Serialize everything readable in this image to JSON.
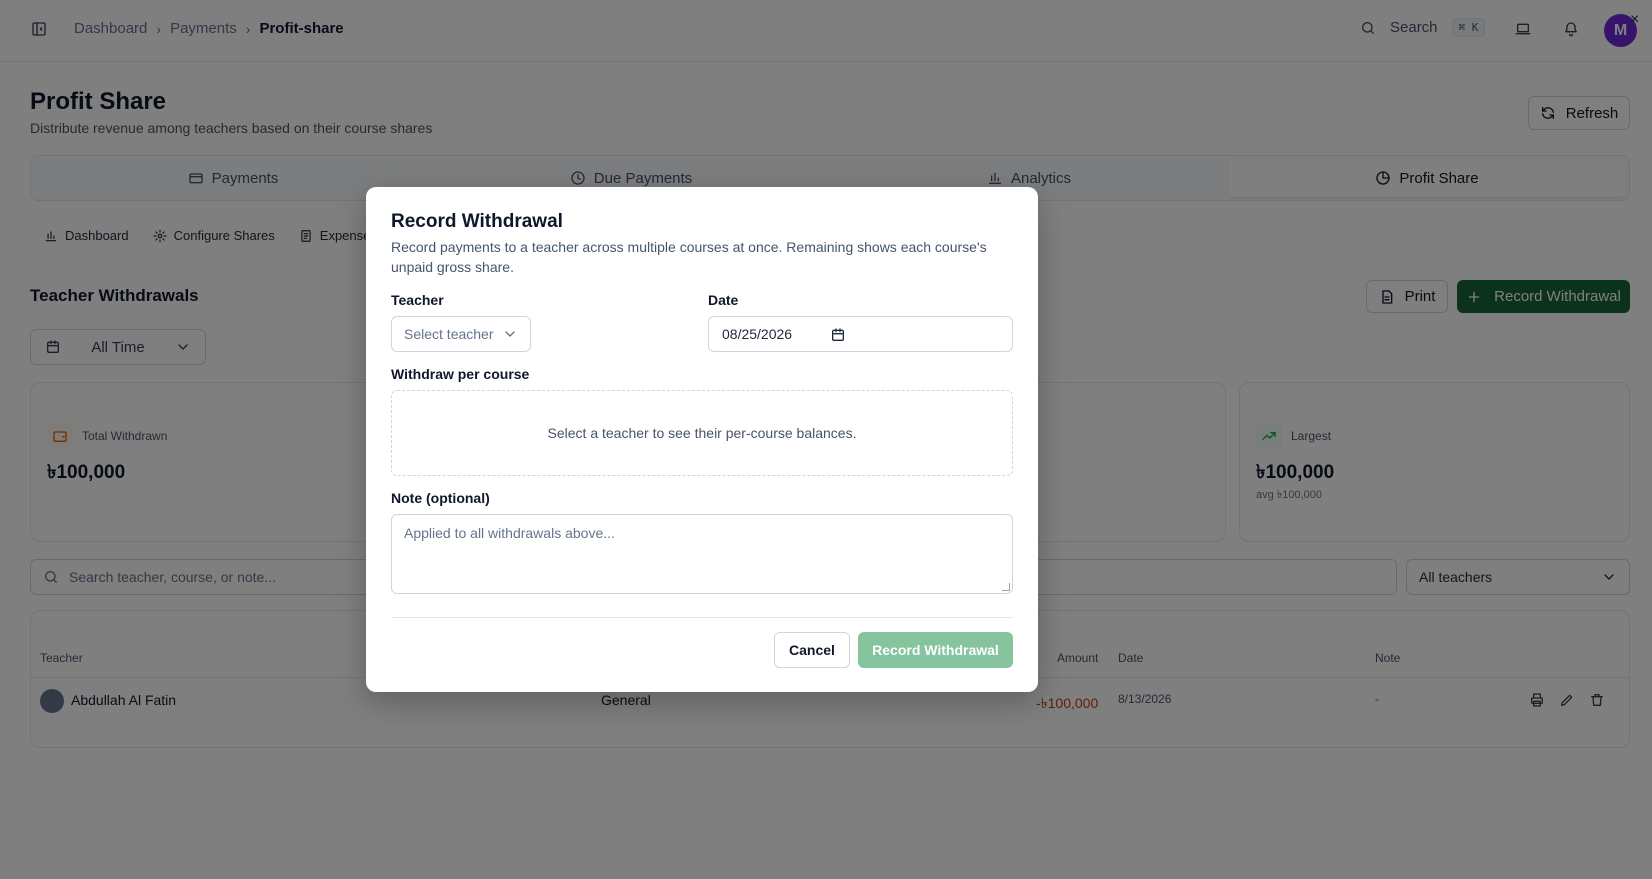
{
  "breadcrumb": {
    "items": [
      "Dashboard",
      "Payments"
    ],
    "current": "Profit-share"
  },
  "topbar": {
    "search_label": "Search",
    "search_shortcut": "⌘ K",
    "avatar_letter": "M",
    "close_glyph": "×"
  },
  "page": {
    "title": "Profit Share",
    "subtitle": "Distribute revenue among teachers based on their course shares",
    "refresh_label": "Refresh"
  },
  "tabs": [
    {
      "label": "Payments",
      "icon": "credit-card-icon"
    },
    {
      "label": "Due Payments",
      "icon": "clock-icon"
    },
    {
      "label": "Analytics",
      "icon": "bar-chart-icon"
    },
    {
      "label": "Profit Share",
      "icon": "pie-chart-icon",
      "active": true
    }
  ],
  "subnav": [
    {
      "label": "Dashboard",
      "icon": "bar-chart-icon"
    },
    {
      "label": "Configure Shares",
      "icon": "gear-icon"
    },
    {
      "label": "Expenses",
      "icon": "receipt-icon"
    }
  ],
  "withdrawals": {
    "title": "Teacher Withdrawals",
    "print_label": "Print",
    "record_label": "Record Withdrawal",
    "period": "All Time"
  },
  "stats": {
    "total": {
      "label": "Total Withdrawn",
      "value": "৳100,000",
      "icon": "wallet-icon",
      "color": "#ea580c"
    },
    "largest": {
      "label": "Largest",
      "value": "৳100,000",
      "sub": "avg ৳100,000",
      "icon": "trending-up-icon",
      "color": "#16a34a"
    }
  },
  "filters": {
    "search_placeholder": "Search teacher, course, or note...",
    "teacher_filter": "All teachers"
  },
  "table": {
    "headers": {
      "teacher": "Teacher",
      "amount": "Amount",
      "date": "Date",
      "note": "Note"
    },
    "rows": [
      {
        "teacher": "Abdullah Al Fatin",
        "course": "General",
        "amount": "-৳100,000",
        "date": "8/13/2026",
        "note": "-"
      }
    ]
  },
  "modal": {
    "title": "Record Withdrawal",
    "description": "Record payments to a teacher across multiple courses at once. Remaining shows each course's unpaid gross share.",
    "teacher_label": "Teacher",
    "teacher_placeholder": "Select teacher",
    "date_label": "Date",
    "date_value": "08/25/2026",
    "course_label": "Withdraw per course",
    "course_empty": "Select a teacher to see their per-course balances.",
    "note_label": "Note (optional)",
    "note_placeholder": "Applied to all withdrawals above...",
    "cancel_label": "Cancel",
    "submit_label": "Record Withdrawal"
  },
  "colors": {
    "primary": "#166534",
    "primary_disabled": "#86c49e",
    "amount_negative": "#c2410c",
    "avatar": "#6d28d9"
  }
}
